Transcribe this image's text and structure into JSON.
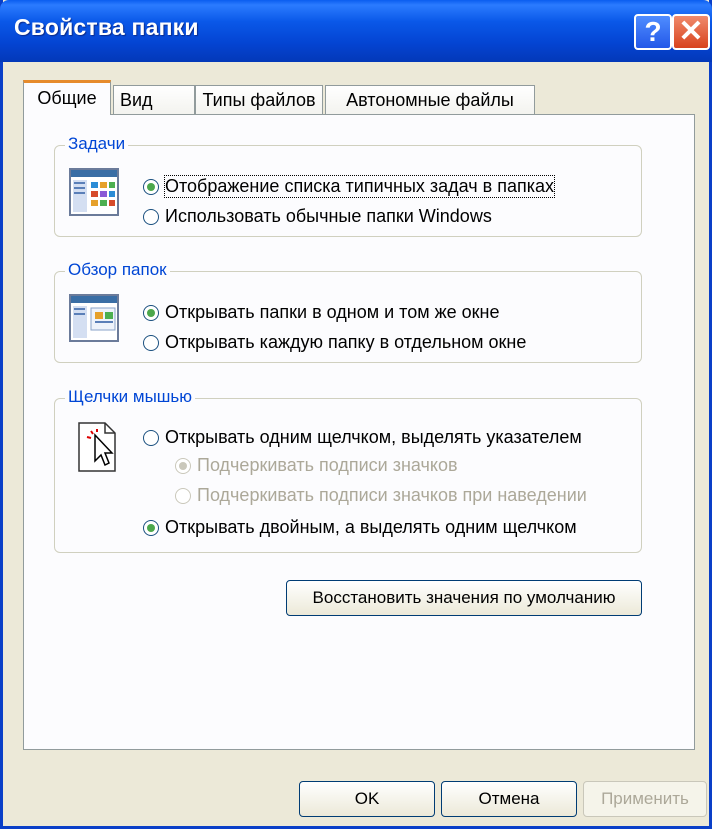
{
  "window": {
    "title": "Свойства папки"
  },
  "titlebar": {
    "help_label": "?",
    "close_label": "✕"
  },
  "tabs": [
    {
      "label": "Общие"
    },
    {
      "label": "Вид"
    },
    {
      "label": "Типы файлов"
    },
    {
      "label": "Автономные файлы"
    }
  ],
  "groups": {
    "tasks": {
      "legend": "Задачи",
      "options": [
        {
          "label": "Отображение списка типичных задач в папках",
          "selected": true
        },
        {
          "label": "Использовать обычные папки Windows",
          "selected": false
        }
      ]
    },
    "browse": {
      "legend": "Обзор папок",
      "options": [
        {
          "label": "Открывать папки в одном и том же окне",
          "selected": true
        },
        {
          "label": "Открывать каждую папку в отдельном окне",
          "selected": false
        }
      ]
    },
    "clicks": {
      "legend": "Щелчки мышью",
      "options": [
        {
          "label": "Открывать одним щелчком, выделять указателем",
          "selected": false,
          "enabled": true
        },
        {
          "label": "Подчеркивать подписи значков",
          "selected": true,
          "enabled": false
        },
        {
          "label": "Подчеркивать подписи значков при наведении",
          "selected": false,
          "enabled": false
        },
        {
          "label": "Открывать двойным, а выделять одним щелчком",
          "selected": true,
          "enabled": true
        }
      ]
    }
  },
  "restore_label": "Восстановить значения по умолчанию",
  "footer": {
    "ok_label": "OK",
    "cancel_label": "Отмена",
    "apply_label": "Применить"
  }
}
